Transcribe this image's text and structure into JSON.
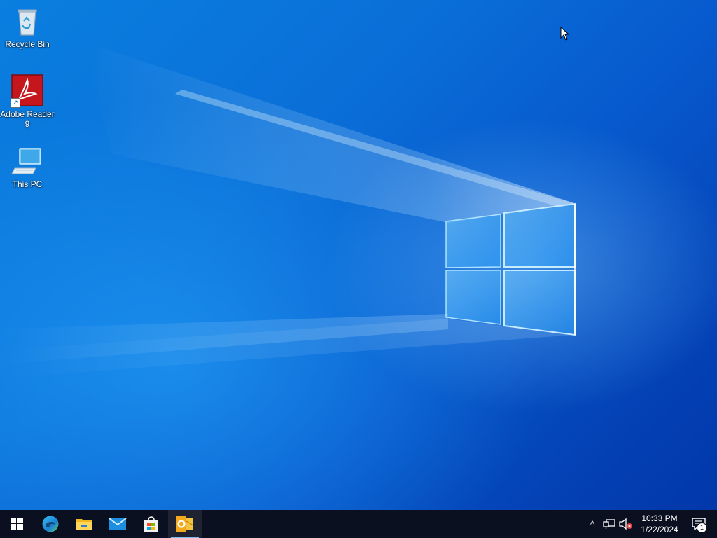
{
  "desktop": {
    "icons": [
      {
        "label": "Recycle Bin",
        "icon": "recycle-bin-icon"
      },
      {
        "label": "Adobe Reader 9",
        "icon": "adobe-reader-icon"
      },
      {
        "label": "This PC",
        "icon": "this-pc-icon"
      }
    ],
    "wallpaper": "windows-10-hero",
    "colors": {
      "accent": "#0a6fd8",
      "taskbar": "#0b1020",
      "adobe_red": "#c4161c"
    }
  },
  "taskbar": {
    "start": {
      "icon": "windows-start-icon"
    },
    "pinned": [
      {
        "icon": "edge-icon",
        "active": false
      },
      {
        "icon": "file-explorer-icon",
        "active": false
      },
      {
        "icon": "mail-icon",
        "active": false
      },
      {
        "icon": "microsoft-store-icon",
        "active": false
      },
      {
        "icon": "outlook-icon",
        "active": true
      }
    ],
    "tray": {
      "chevron": "^",
      "network_icon": "network-icon",
      "volume_icon": "volume-muted-icon",
      "time": "10:33 PM",
      "date": "1/22/2024",
      "notification_count": "1"
    }
  }
}
